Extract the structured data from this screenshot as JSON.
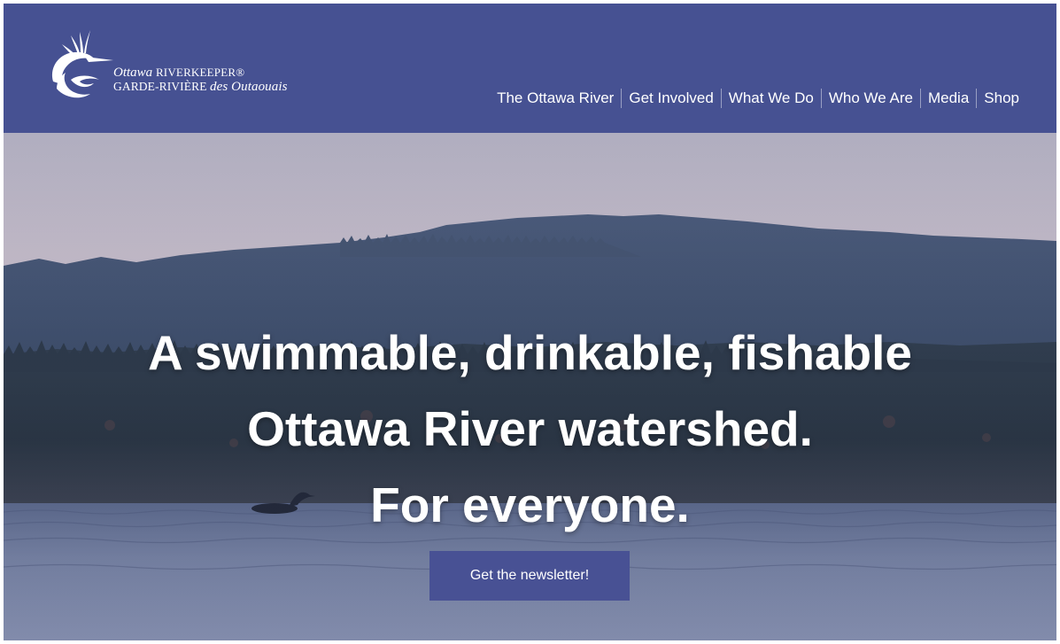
{
  "brand": {
    "name_line1_italic": "Ottawa",
    "name_line1_caps": "RIVERKEEPER®",
    "name_line2_caps": "GARDE-RIVIÈRE",
    "name_line2_italic": "des Outaouais",
    "logo_icon": "heron-wave-logo-icon"
  },
  "nav": {
    "items": [
      {
        "label": "The Ottawa River"
      },
      {
        "label": "Get Involved"
      },
      {
        "label": "What We Do"
      },
      {
        "label": "Who We Are"
      },
      {
        "label": "Media"
      },
      {
        "label": "Shop"
      }
    ]
  },
  "hero": {
    "headline_line1": "A swimmable, drinkable, fishable",
    "headline_line2": "Ottawa River watershed.",
    "headline_line3": "For everyone.",
    "cta_label": "Get the newsletter!"
  },
  "colors": {
    "header_bg": "#465192",
    "button_bg": "#485194",
    "text": "#ffffff"
  }
}
